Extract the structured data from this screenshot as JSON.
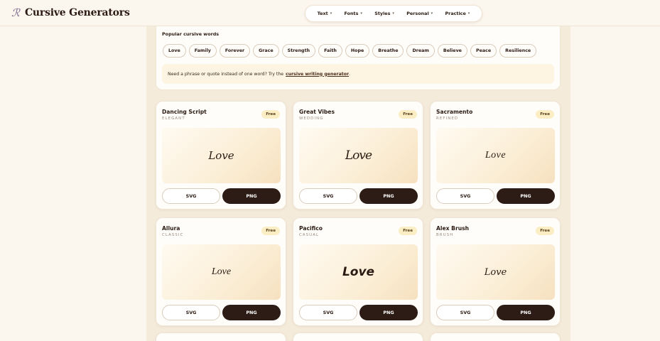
{
  "header": {
    "logo_mark": "ℛ",
    "logo_text": "Cursive Generators",
    "nav": [
      {
        "label": "Text"
      },
      {
        "label": "Fonts"
      },
      {
        "label": "Styles"
      },
      {
        "label": "Personal"
      },
      {
        "label": "Practice"
      }
    ],
    "caret": "▾"
  },
  "words": {
    "title": "Popular cursive words",
    "chips": [
      "Love",
      "Family",
      "Forever",
      "Grace",
      "Strength",
      "Faith",
      "Hope",
      "Breathe",
      "Dream",
      "Believe",
      "Peace",
      "Resilience"
    ],
    "tip_text": "Need a phrase or quote instead of one word? Try the",
    "tip_link": "cursive writing generator",
    "tip_end": "."
  },
  "cards": [
    {
      "name": "Dancing Script",
      "tag": "ELEGANT",
      "badge": "Free",
      "preview": "Love",
      "svg": "SVG",
      "png": "PNG"
    },
    {
      "name": "Great Vibes",
      "tag": "WEDDING",
      "badge": "Free",
      "preview": "Love",
      "svg": "SVG",
      "png": "PNG"
    },
    {
      "name": "Sacramento",
      "tag": "REFINED",
      "badge": "Free",
      "preview": "Love",
      "svg": "SVG",
      "png": "PNG"
    },
    {
      "name": "Allura",
      "tag": "CLASSIC",
      "badge": "Free",
      "preview": "Love",
      "svg": "SVG",
      "png": "PNG"
    },
    {
      "name": "Pacifico",
      "tag": "CASUAL",
      "badge": "Free",
      "preview": "Love",
      "svg": "SVG",
      "png": "PNG"
    },
    {
      "name": "Alex Brush",
      "tag": "BRUSH",
      "badge": "Free",
      "preview": "Love",
      "svg": "SVG",
      "png": "PNG"
    }
  ],
  "colors": {
    "background": "#fbf6ee",
    "accent_dark": "#2d1b15",
    "badge_bg": "#fbeec4"
  }
}
